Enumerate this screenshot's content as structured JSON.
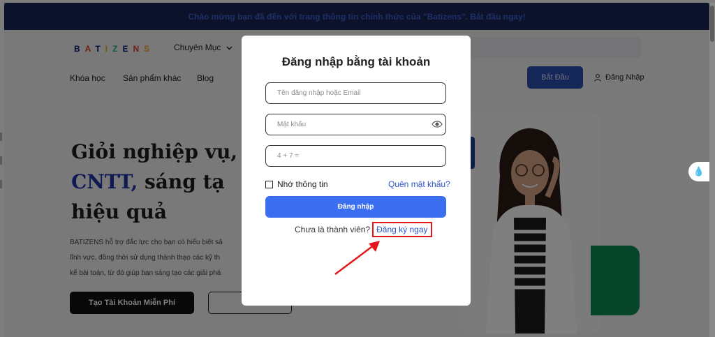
{
  "announcement": "Chào mừng bạn đã đến với trang thông tin chính thức của \"Batizens\". Bắt đầu ngay!",
  "brand": {
    "logo_letters": [
      "B",
      "A",
      "T",
      "I",
      "Z",
      "E",
      "N",
      "S"
    ]
  },
  "header": {
    "category_label": "Chuyên Mục",
    "nav_links": [
      "Khóa học",
      "Sản phẩm khác",
      "Blog"
    ],
    "start_button": "Bắt Đầu",
    "login_link": "Đăng Nhập"
  },
  "hero": {
    "title_line1": "Giỏi nghiệp vụ,",
    "title_highlight": "CNTT,",
    "title_line2_rest": "sáng tạ",
    "title_line3": "hiệu quả",
    "desc_line1": "BATIZENS hỗ trợ đắc lực cho bạn có hiểu biết sâ",
    "desc_line2": "lĩnh vực, đồng thời sử dụng thành thạo các kỹ th",
    "desc_line3": "kế bài toán, từ đó giúp bạn sáng tạo các giải phá",
    "btn_free": "Tạo Tài Khoản Miễn Phí"
  },
  "login_modal": {
    "title": "Đăng nhập bằng tài khoản",
    "username_placeholder": "Tên đăng nhập hoặc Email",
    "password_placeholder": "Mật khẩu",
    "captcha_placeholder": "4 + 7 =",
    "remember_label": "Nhớ thông tin",
    "forgot_label": "Quên mật khẩu?",
    "login_button": "Đăng nhập",
    "not_member_text": "Chưa là thành viên?",
    "signup_link": "Đăng ký ngay"
  },
  "colors": {
    "primary": "#3a6df0",
    "link": "#2c56c9",
    "highlight_box": "#e3161c",
    "annotation_arrow": "#e3161c",
    "green_accent": "#0f8a55"
  },
  "icons": {
    "password_toggle": "eye-icon",
    "user": "user-icon",
    "chevron": "chevron-down-icon",
    "side_widget": "water-drop-icon"
  }
}
